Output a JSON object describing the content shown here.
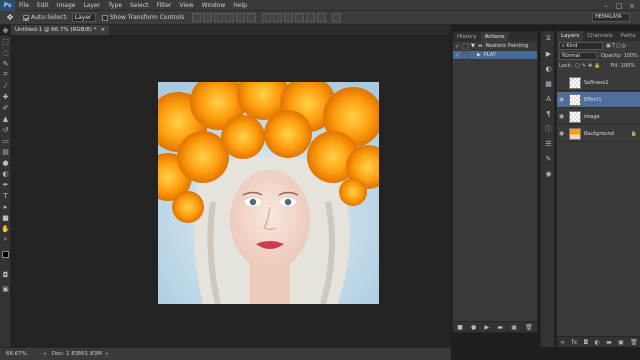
{
  "menubar": {
    "logo": "Ps",
    "items": [
      "File",
      "Edit",
      "Image",
      "Layer",
      "Type",
      "Select",
      "Filter",
      "View",
      "Window",
      "Help"
    ]
  },
  "options": {
    "auto_select_label": "Auto-Select:",
    "auto_select_value": "Layer",
    "show_transform_label": "Show Transform Controls",
    "workspace": "HEMALAYA"
  },
  "document": {
    "tab_title": "Untitled-1 @ 66.7% (RGB/8) *",
    "close": "×"
  },
  "statusbar": {
    "zoom": "66.67%",
    "doc_info": "Doc: 1.83M/1.83M"
  },
  "history_panel": {
    "tabs": [
      "History",
      "Actions"
    ],
    "actions": [
      {
        "label": "Realistic Painting",
        "checked": true,
        "expanded": true
      },
      {
        "label": "PLAY",
        "checked": true,
        "expanded": false
      }
    ]
  },
  "layers_panel": {
    "tabs": [
      "Layers",
      "Channels",
      "Paths"
    ],
    "kind_label": "Kind",
    "blend_mode": "Normal",
    "opacity_label": "Opacity:",
    "opacity_value": "100%",
    "lock_label": "Lock:",
    "fill_label": "Fill:",
    "fill_value": "100%",
    "layers": [
      {
        "name": "Softness1",
        "visible": false,
        "selected": false
      },
      {
        "name": "Effect1",
        "visible": true,
        "selected": true
      },
      {
        "name": "image",
        "visible": true,
        "selected": false
      },
      {
        "name": "Background",
        "visible": true,
        "selected": false
      }
    ]
  },
  "colors": {
    "foreground": "#000000",
    "background": "#ffffff",
    "selection": "#4f6d9c"
  }
}
